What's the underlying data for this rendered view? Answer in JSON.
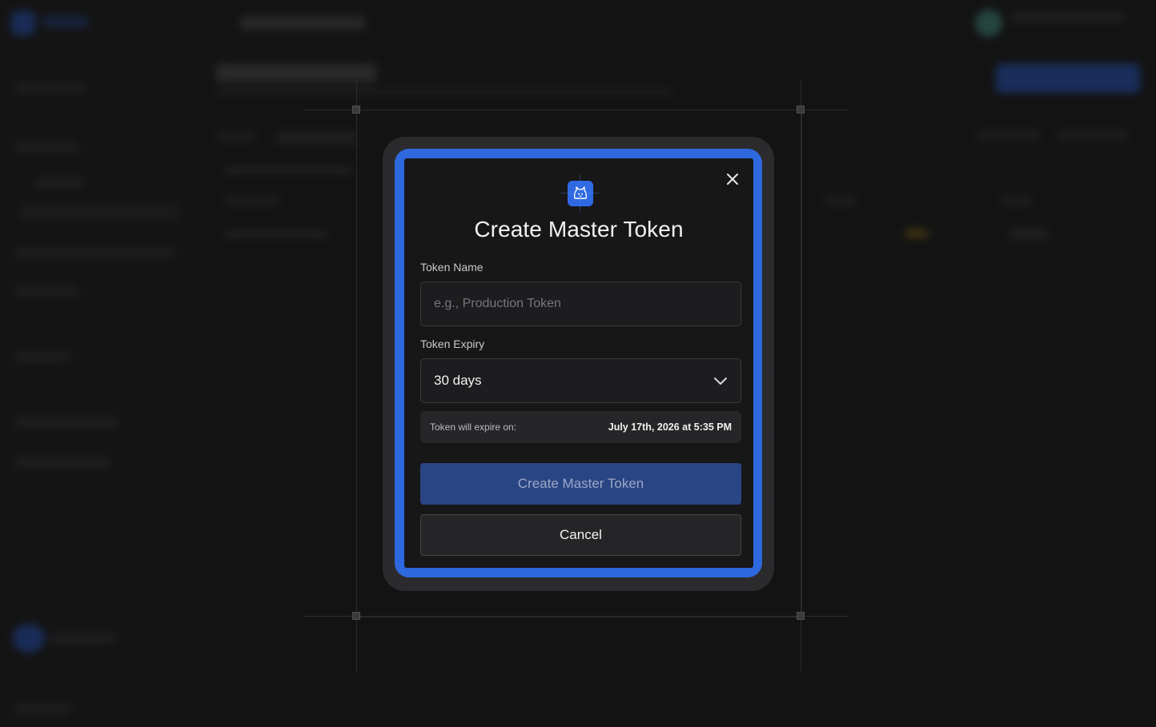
{
  "modal": {
    "title": "Create Master Token",
    "logo_icon": "cat-logo-icon",
    "close_icon": "close-icon",
    "token_name": {
      "label": "Token Name",
      "placeholder": "e.g., Production Token",
      "value": ""
    },
    "token_expiry": {
      "label": "Token Expiry",
      "selected": "30 days",
      "icon": "chevron-down-icon"
    },
    "expiry_info": {
      "label": "Token will expire on:",
      "value": "July 17th, 2026 at 5:35 PM"
    },
    "primary_button": "Create Master Token",
    "cancel_button": "Cancel"
  },
  "colors": {
    "accent": "#2e68de",
    "primary_button_disabled": "#2a4583",
    "modal_background": "#171718",
    "page_background": "#1a1a1b"
  }
}
